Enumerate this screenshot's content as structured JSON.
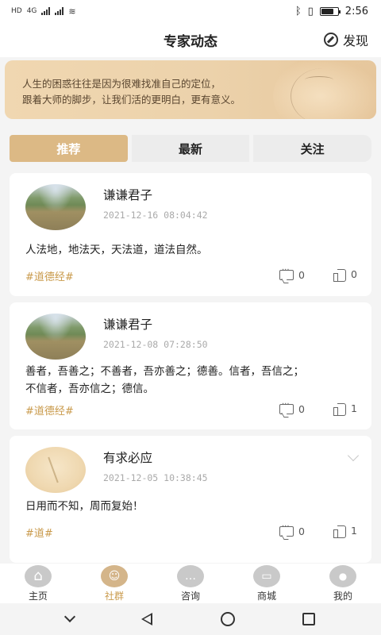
{
  "status_bar": {
    "left_label_1": "HD",
    "left_label_2": "4G",
    "time": "2:56"
  },
  "header": {
    "title": "专家动态",
    "discover_label": "发现"
  },
  "banner": {
    "line1": "人生的困惑往往是因为很难找准自己的定位，",
    "line2": "跟着大师的脚步，让我们活的更明白，更有意义。"
  },
  "tabs": [
    "推荐",
    "最新",
    "关注"
  ],
  "posts": [
    {
      "username": "谦谦君子",
      "time": "2021-12-16 08:04:42",
      "content_lines": [
        "人法地，地法天，天法道，道法自然。"
      ],
      "tag": "#道德经#",
      "comments": "0",
      "likes": "0"
    },
    {
      "username": "谦谦君子",
      "time": "2021-12-08 07:28:50",
      "content_lines": [
        "善者，吾善之；不善者，吾亦善之；德善。信者，吾信之；",
        "不信者，吾亦信之；德信。"
      ],
      "tag": "#道德经#",
      "comments": "0",
      "likes": "1"
    },
    {
      "username": "有求必应",
      "time": "2021-12-05 10:38:45",
      "content_lines": [
        "日用而不知，周而复始！"
      ],
      "tag": "#道#",
      "comments": "0",
      "likes": "1"
    }
  ],
  "bottom_nav": [
    {
      "label": "主页",
      "icon": "home-icon"
    },
    {
      "label": "社群",
      "icon": "community-icon"
    },
    {
      "label": "咨询",
      "icon": "chat-icon"
    },
    {
      "label": "商城",
      "icon": "shop-icon"
    },
    {
      "label": "我的",
      "icon": "profile-icon"
    }
  ],
  "battery_level": 0.75,
  "colors": {
    "accent": "#dcb985",
    "tag": "#c99a4b",
    "background": "#f4f4f4"
  }
}
